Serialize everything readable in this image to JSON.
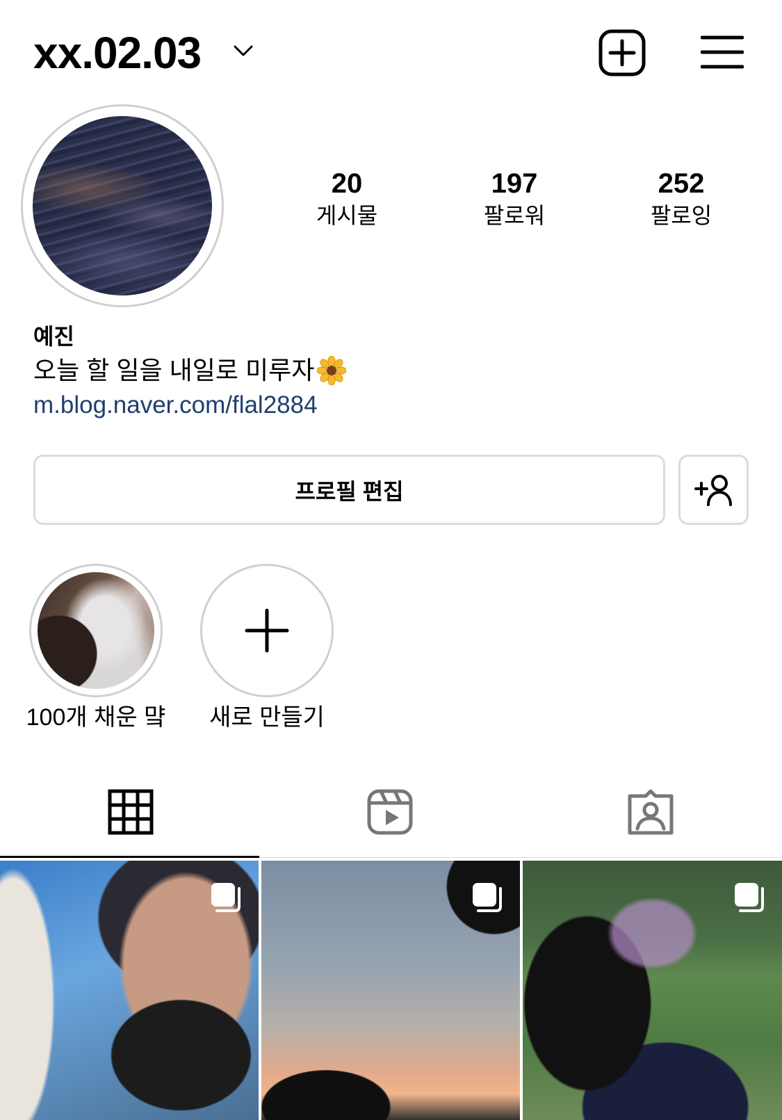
{
  "header": {
    "username": "xx.02.03",
    "dropdown_icon": "chevron-down-icon",
    "new_post_icon": "plus-square-icon",
    "menu_icon": "hamburger-menu-icon"
  },
  "stats": {
    "posts": {
      "count": "20",
      "label": "게시물"
    },
    "followers": {
      "count": "197",
      "label": "팔로워"
    },
    "following": {
      "count": "252",
      "label": "팔로잉"
    }
  },
  "profile": {
    "name": "예진",
    "bio": "오늘 할 일을 내일로 미루자",
    "bio_emoji": "sunflower",
    "link": "m.blog.naver.com/flal2884"
  },
  "actions": {
    "edit_profile_label": "프로필 편집",
    "discover_people_icon": "add-person-icon"
  },
  "highlights": [
    {
      "label": "100개 채운 먘"
    },
    {
      "label": "새로 만들기"
    }
  ],
  "tabs": [
    {
      "name": "posts",
      "icon": "grid-icon",
      "active": true
    },
    {
      "name": "reels",
      "icon": "reels-icon",
      "active": false
    },
    {
      "name": "tagged",
      "icon": "tagged-icon",
      "active": false
    }
  ],
  "colors": {
    "link": "#1e3e6e",
    "border": "#dbdbdb",
    "text": "#000000"
  }
}
